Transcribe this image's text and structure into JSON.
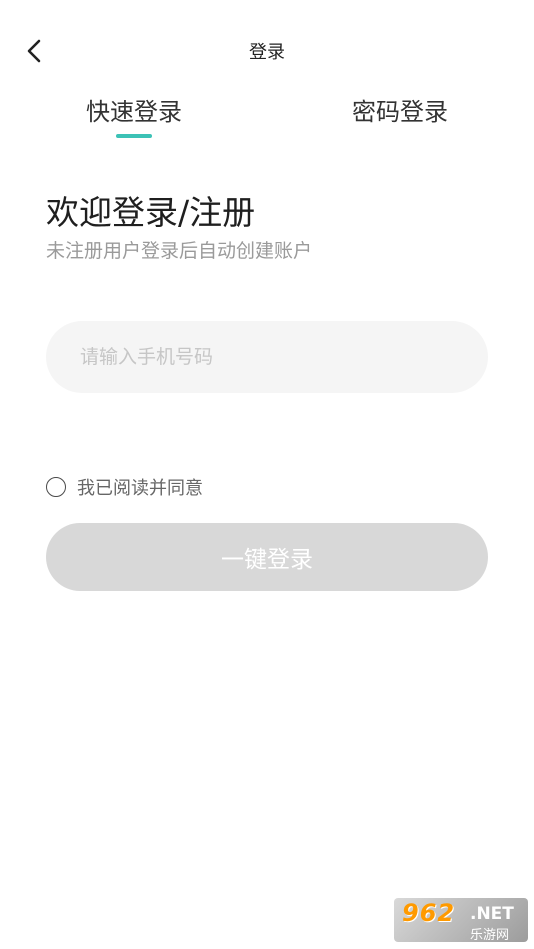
{
  "header": {
    "title": "登录",
    "back_icon": "chevron-left-icon"
  },
  "tabs": [
    {
      "label": "快速登录",
      "active": true
    },
    {
      "label": "密码登录",
      "active": false
    }
  ],
  "colors": {
    "accent": "#3cc2b6",
    "button_disabled": "#d8d8d8",
    "input_bg": "#f5f5f5"
  },
  "welcome": {
    "title": "欢迎登录/注册",
    "subtitle": "未注册用户登录后自动创建账户"
  },
  "phone_input": {
    "value": "",
    "placeholder": "请输入手机号码"
  },
  "agreement": {
    "checked": false,
    "label": "我已阅读并同意"
  },
  "login_button": {
    "label": "一键登录"
  },
  "watermark": {
    "brand": "962",
    "domain": ".NET",
    "tag": "乐游网"
  }
}
